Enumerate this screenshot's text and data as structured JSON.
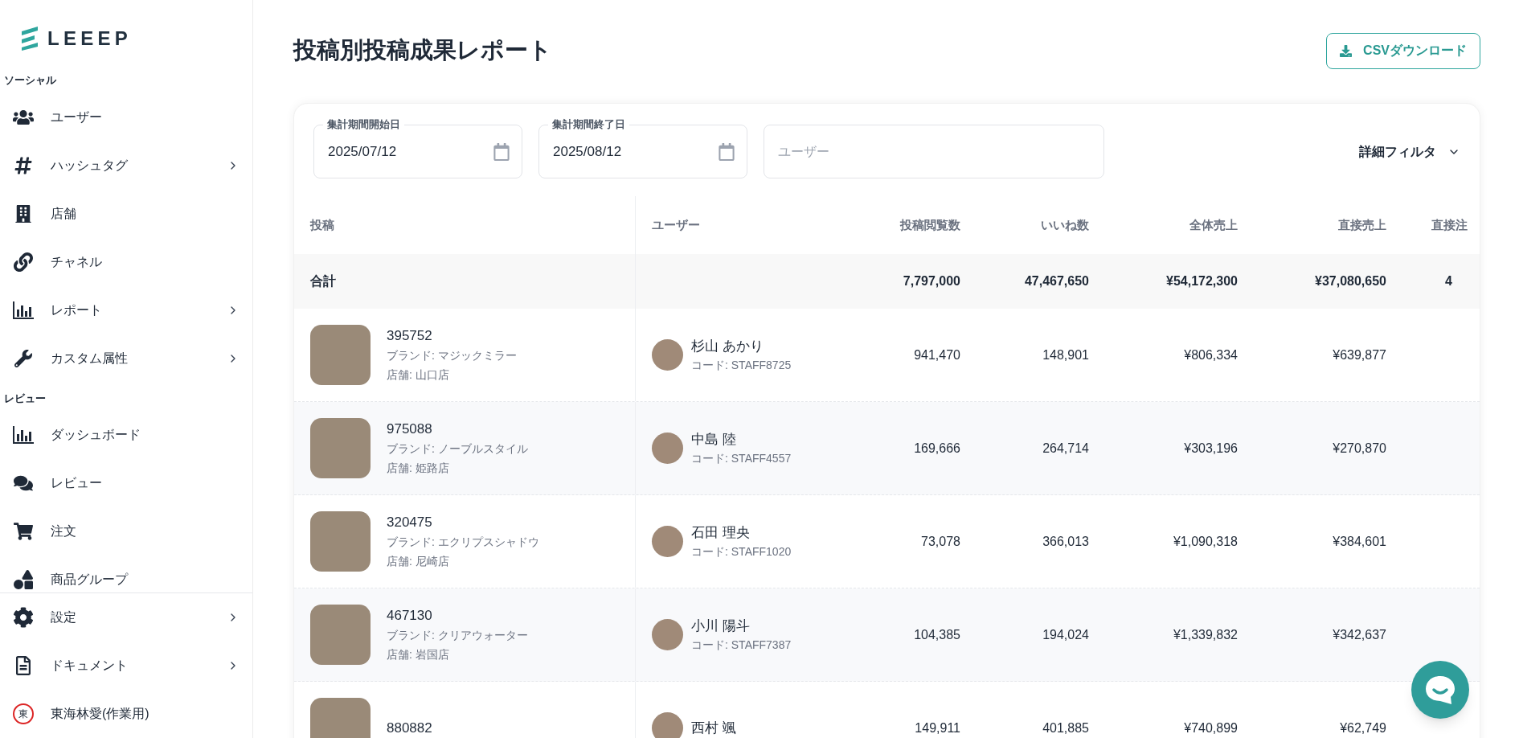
{
  "logo": {
    "text": "LEEEP"
  },
  "sidebar": {
    "sections": [
      {
        "label": "ソーシャル",
        "items": [
          {
            "label": "ユーザー",
            "expandable": false
          },
          {
            "label": "ハッシュタグ",
            "expandable": true
          },
          {
            "label": "店舗",
            "expandable": false
          },
          {
            "label": "チャネル",
            "expandable": false
          },
          {
            "label": "レポート",
            "expandable": true
          },
          {
            "label": "カスタム属性",
            "expandable": true
          }
        ]
      },
      {
        "label": "レビュー",
        "items": [
          {
            "label": "ダッシュボード",
            "expandable": false
          },
          {
            "label": "レビュー",
            "expandable": false
          },
          {
            "label": "注文",
            "expandable": false
          },
          {
            "label": "商品グループ",
            "expandable": false
          }
        ]
      }
    ],
    "footer_items": [
      {
        "label": "設定",
        "expandable": true
      },
      {
        "label": "ドキュメント",
        "expandable": true
      }
    ],
    "account": {
      "badge": "東",
      "name": "東海林愛(作業用)"
    }
  },
  "page": {
    "title": "投稿別投稿成果レポート",
    "export_button": "CSVダウンロード"
  },
  "filters": {
    "start_date": {
      "label": "集計期間開始日",
      "value": "2025/07/12"
    },
    "end_date": {
      "label": "集計期間終了日",
      "value": "2025/08/12"
    },
    "user": {
      "placeholder": "ユーザー"
    },
    "detail_filter": "詳細フィルタ"
  },
  "table": {
    "columns": [
      "投稿",
      "ユーザー",
      "投稿閲覧数",
      "いいね数",
      "全体売上",
      "直接売上",
      "直接注"
    ],
    "total": {
      "label": "合計",
      "values": [
        "7,797,000",
        "47,467,650",
        "¥54,172,300",
        "¥37,080,650",
        "4"
      ]
    },
    "rows": [
      {
        "post_id": "395752",
        "brand": "ブランド: マジックミラー",
        "store": "店舗: 山口店",
        "user_name": "杉山 あかり",
        "user_code": "コード: STAFF8725",
        "values": [
          "941,470",
          "148,901",
          "¥806,334",
          "¥639,877"
        ]
      },
      {
        "post_id": "975088",
        "brand": "ブランド: ノーブルスタイル",
        "store": "店舗: 姫路店",
        "user_name": "中島 陸",
        "user_code": "コード: STAFF4557",
        "values": [
          "169,666",
          "264,714",
          "¥303,196",
          "¥270,870"
        ]
      },
      {
        "post_id": "320475",
        "brand": "ブランド: エクリプスシャドウ",
        "store": "店舗: 尼崎店",
        "user_name": "石田 理央",
        "user_code": "コード: STAFF1020",
        "values": [
          "73,078",
          "366,013",
          "¥1,090,318",
          "¥384,601"
        ]
      },
      {
        "post_id": "467130",
        "brand": "ブランド: クリアウォーター",
        "store": "店舗: 岩国店",
        "user_name": "小川 陽斗",
        "user_code": "コード: STAFF7387",
        "values": [
          "104,385",
          "194,024",
          "¥1,339,832",
          "¥342,637"
        ]
      },
      {
        "post_id": "880882",
        "user_name": "西村 颯",
        "values": [
          "149,911",
          "401,885",
          "¥740,899",
          "¥62,749"
        ]
      }
    ]
  }
}
